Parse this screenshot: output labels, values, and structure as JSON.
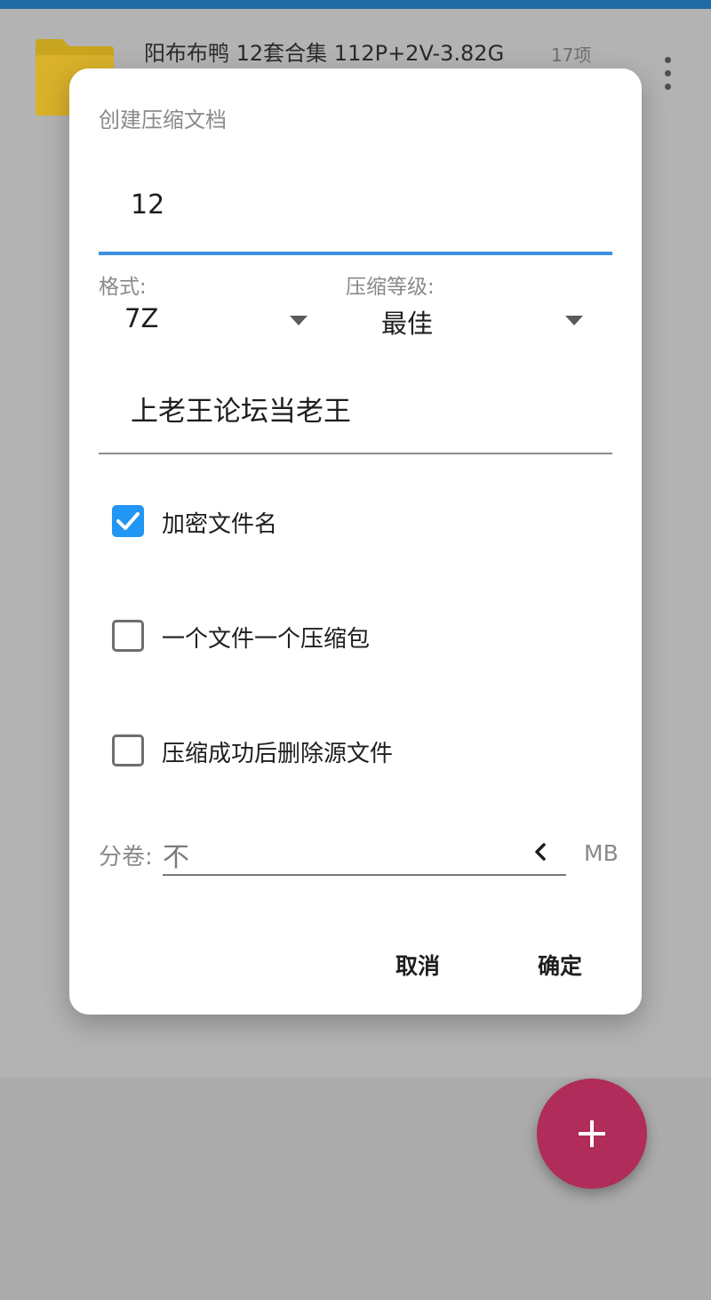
{
  "background": {
    "folder_title": "阳布布鸭 12套合集 112P+2V-3.82G",
    "folder_count": "17项",
    "overflow_icon": "more-vert-icon",
    "fab_icon": "plus-icon"
  },
  "dialog": {
    "title": "创建压缩文档",
    "archive_name": "12",
    "format_label": "格式:",
    "format_value": "7Z",
    "level_label": "压缩等级:",
    "level_value": "最佳",
    "password": "上老王论坛当老王",
    "options": [
      {
        "label": "加密文件名",
        "checked": true
      },
      {
        "label": "一个文件一个压缩包",
        "checked": false
      },
      {
        "label": "压缩成功后删除源文件",
        "checked": false
      }
    ],
    "split_label": "分卷:",
    "split_value": "不",
    "split_unit": "MB",
    "cancel_label": "取消",
    "ok_label": "确定"
  },
  "colors": {
    "accent": "#2196f3",
    "input_focus": "#3d8fe0",
    "fab": "#b02c5a",
    "status_bar": "#1f6aa5"
  }
}
